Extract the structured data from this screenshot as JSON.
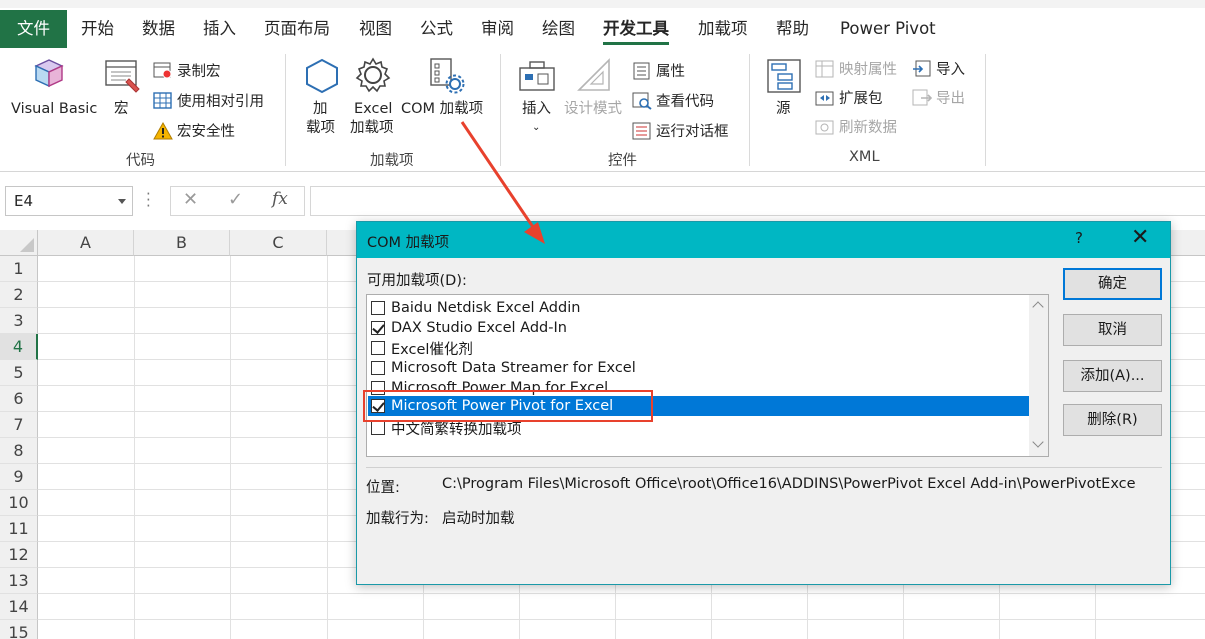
{
  "tabs": [
    {
      "label": "文件",
      "kind": "file"
    },
    {
      "label": "开始"
    },
    {
      "label": "数据"
    },
    {
      "label": "插入"
    },
    {
      "label": "页面布局"
    },
    {
      "label": "视图"
    },
    {
      "label": "公式"
    },
    {
      "label": "审阅"
    },
    {
      "label": "绘图"
    },
    {
      "label": "开发工具",
      "active": true
    },
    {
      "label": "加载项"
    },
    {
      "label": "帮助"
    },
    {
      "label": "Power Pivot"
    }
  ],
  "ribbon": {
    "code": {
      "label": "代码",
      "visual_basic": "Visual Basic",
      "macros": "宏",
      "record_macro": "录制宏",
      "relative_ref": "使用相对引用",
      "macro_security": "宏安全性"
    },
    "addins": {
      "label": "加载项",
      "addins_line1": "加",
      "addins_line2": "载项",
      "excel_addins_line1": "Excel",
      "excel_addins_line2": "加载项",
      "com_addins": "COM 加载项"
    },
    "controls": {
      "label": "控件",
      "insert": "插入",
      "design_mode": "设计模式",
      "properties": "属性",
      "view_code": "查看代码",
      "run_dialog": "运行对话框"
    },
    "xml": {
      "label": "XML",
      "source": "源",
      "map_properties": "映射属性",
      "expansion_packs": "扩展包",
      "refresh_data": "刷新数据",
      "import": "导入",
      "export": "导出"
    }
  },
  "formula_bar": {
    "name_box": "E4",
    "cancel_glyph": "✕",
    "enter_glyph": "✓",
    "fx_glyph": "fx"
  },
  "grid": {
    "columns": [
      "A",
      "B",
      "C"
    ],
    "rows": [
      "1",
      "2",
      "3",
      "4",
      "5",
      "6",
      "7",
      "8",
      "9",
      "10",
      "11",
      "12",
      "13",
      "14",
      "15"
    ],
    "selected_row": "4"
  },
  "dialog": {
    "title": "COM 加载项",
    "help": "?",
    "close": "✕",
    "available_label": "可用加载项(D):",
    "items": [
      {
        "label": "Baidu Netdisk Excel Addin",
        "checked": false
      },
      {
        "label": "DAX Studio Excel Add-In",
        "checked": true
      },
      {
        "label": "Excel催化剂",
        "checked": false
      },
      {
        "label": "Microsoft Data Streamer for Excel",
        "checked": false
      },
      {
        "label": "Microsoft Power Map for Excel",
        "checked": false
      },
      {
        "label": "Microsoft Power Pivot for Excel",
        "checked": true,
        "selected": true
      },
      {
        "label": "中文简繁转换加载项",
        "checked": false
      }
    ],
    "buttons": {
      "ok": "确定",
      "cancel": "取消",
      "add": "添加(A)...",
      "remove": "删除(R)"
    },
    "location_key": "位置:",
    "location_value": "C:\\Program Files\\Microsoft Office\\root\\Office16\\ADDINS\\PowerPivot Excel Add-in\\PowerPivotExce",
    "load_behavior_key": "加载行为:",
    "load_behavior_value": "启动时加载"
  },
  "colors": {
    "excel_green": "#217346",
    "dialog_title": "#00b7c3",
    "selection_blue": "#0078d7",
    "annotation_red": "#e8412d"
  }
}
